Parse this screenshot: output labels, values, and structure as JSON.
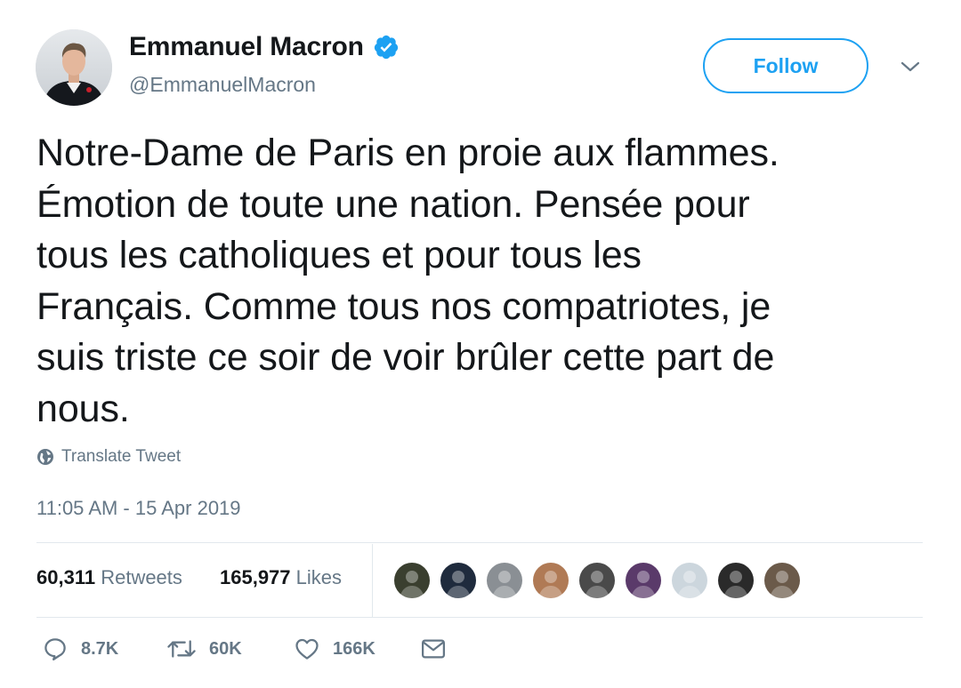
{
  "user": {
    "display_name": "Emmanuel Macron",
    "handle": "@EmmanuelMacron",
    "verified": true
  },
  "header": {
    "follow_label": "Follow"
  },
  "tweet": {
    "text": "Notre-Dame de Paris en proie aux flammes.\nÉmotion de toute une nation. Pensée pour\ntous les catholiques et pour tous les\nFrançais. Comme tous nos compatriotes, je\nsuis triste ce soir de voir brûler cette part de\nnous.",
    "translate_label": "Translate Tweet",
    "timestamp": "11:05 AM - 15 Apr 2019"
  },
  "stats": {
    "retweets_count": "60,311",
    "retweets_label": "Retweets",
    "likes_count": "165,977",
    "likes_label": "Likes"
  },
  "likers": [
    {
      "name": "liker-avatar-1",
      "color": "#3a3f2f"
    },
    {
      "name": "liker-avatar-2",
      "color": "#1f2b3d"
    },
    {
      "name": "liker-avatar-3",
      "color": "#8a8f94"
    },
    {
      "name": "liker-avatar-4",
      "color": "#b07a55"
    },
    {
      "name": "liker-avatar-5",
      "color": "#4a4a4a"
    },
    {
      "name": "liker-avatar-6",
      "color": "#5a3a6a"
    },
    {
      "name": "liker-avatar-7",
      "color": "#ccd6dd"
    },
    {
      "name": "liker-avatar-8",
      "color": "#2a2a2a"
    },
    {
      "name": "liker-avatar-9",
      "color": "#6b5a4a"
    }
  ],
  "actions": {
    "reply_count": "8.7K",
    "retweet_count": "60K",
    "like_count": "166K"
  },
  "colors": {
    "accent": "#1da1f2",
    "secondary_text": "#657786",
    "primary_text": "#14171a",
    "border": "#e1e8ed"
  }
}
